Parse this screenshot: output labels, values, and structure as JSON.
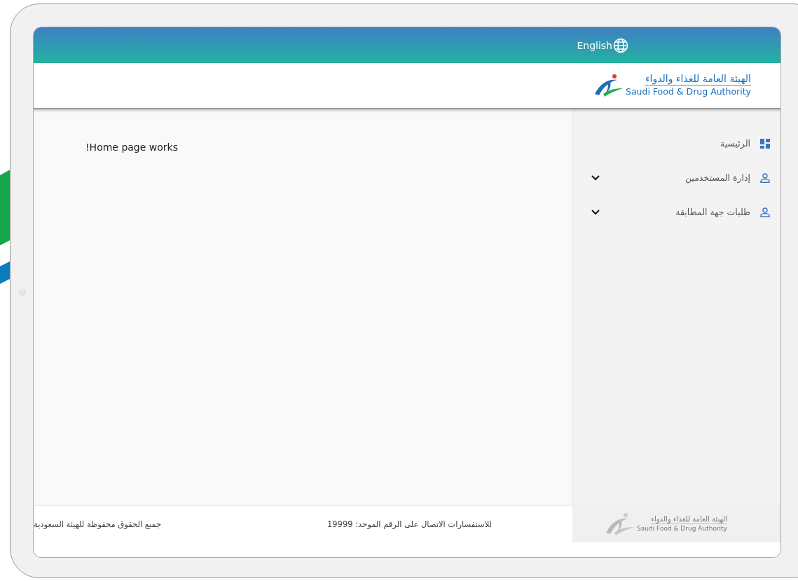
{
  "header": {
    "language_button": "English"
  },
  "logo": {
    "arabic": "الهيئة العامة للغذاء والدواء",
    "english": "Saudi Food & Drug Authority"
  },
  "main": {
    "message": "!Home page works"
  },
  "sidebar": {
    "items": [
      {
        "label": "الرئيسية",
        "kind": "dashboard",
        "expandable": false
      },
      {
        "label": "إدارة المستخدمين",
        "kind": "user",
        "expandable": true
      },
      {
        "label": "طلبات جهة المطابقة",
        "kind": "user",
        "expandable": true
      }
    ]
  },
  "footer": {
    "contact": "للاستفسارات الاتصال على الرقم الموحد: 19999",
    "copyright": "جميع الحقوق محفوظة للهيئة السعودية",
    "logo": {
      "arabic": "الهيئة العامة للغذاء والدواء",
      "english": "Saudi Food & Drug Authority"
    }
  }
}
